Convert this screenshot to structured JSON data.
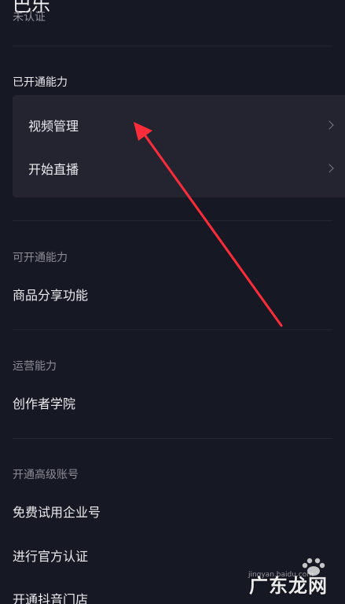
{
  "header": {
    "title": "巴乐",
    "status": "未认证"
  },
  "opened": {
    "title": "已开通能力",
    "items": [
      {
        "label": "视频管理",
        "icon": "chevron-right-icon"
      },
      {
        "label": "开始直播",
        "icon": "chevron-right-icon"
      }
    ]
  },
  "available": {
    "title": "可开通能力",
    "items": [
      {
        "label": "商品分享功能"
      }
    ]
  },
  "operation": {
    "title": "运营能力",
    "items": [
      {
        "label": "创作者学院"
      }
    ]
  },
  "advanced": {
    "title": "开通高级账号",
    "items": [
      {
        "label": "免费试用企业号"
      },
      {
        "label": "进行官方认证"
      },
      {
        "label": "开通抖音门店"
      }
    ]
  },
  "watermark": {
    "name": "广东龙网",
    "url": "jingyan.baidu.com"
  },
  "colors": {
    "background": "#161823",
    "card": "#232430",
    "arrow": "#ff2d3a"
  }
}
